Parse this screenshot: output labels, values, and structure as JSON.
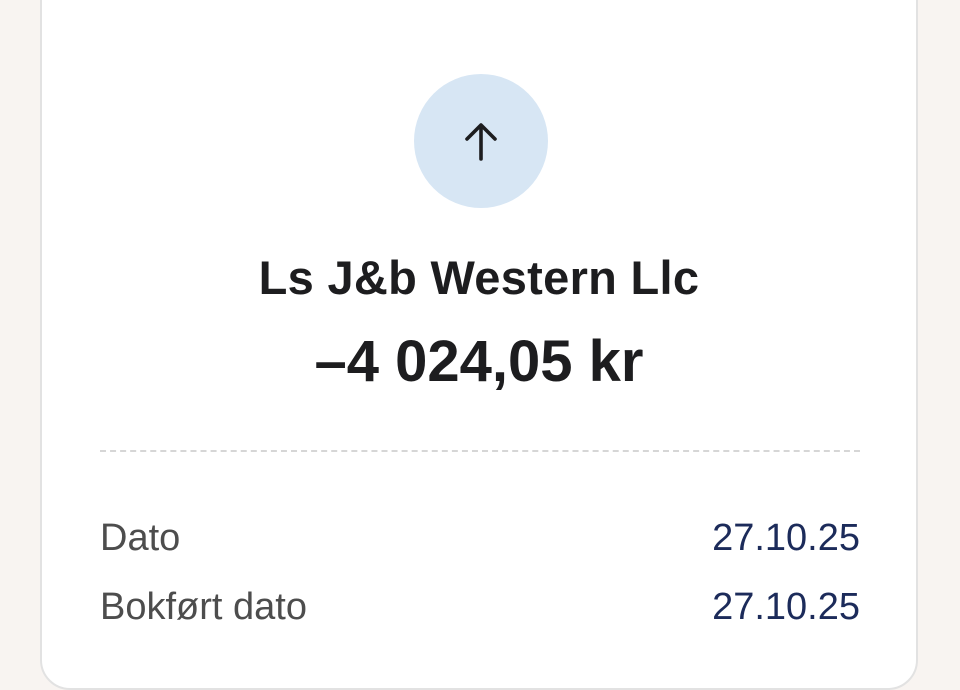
{
  "transaction": {
    "icon": "arrow-up-icon",
    "merchant": "Ls J&b Western Llc",
    "amount": "–4 024,05 kr"
  },
  "details": [
    {
      "label": "Dato",
      "value": "27.10.25"
    },
    {
      "label": "Bokført dato",
      "value": "27.10.25"
    }
  ],
  "colors": {
    "icon_background": "#d7e6f4",
    "value_text": "#1c2b5a",
    "page_background": "#f8f4f1"
  }
}
